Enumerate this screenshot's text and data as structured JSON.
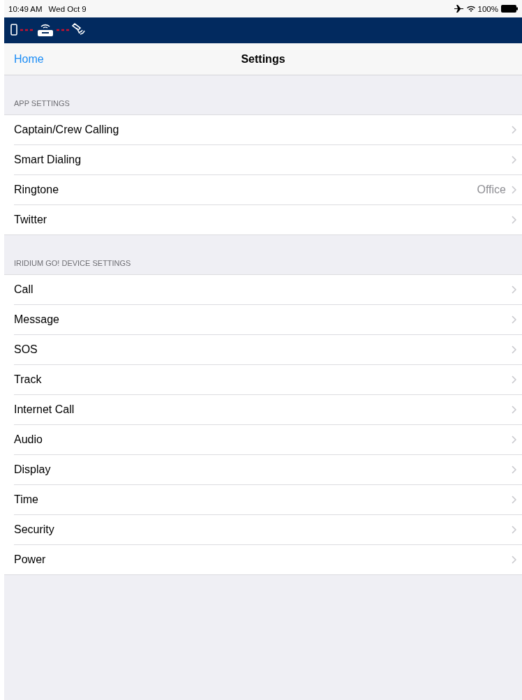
{
  "status_bar": {
    "time": "10:49 AM",
    "date": "Wed Oct 9",
    "battery": "100%"
  },
  "nav_bar": {
    "back": "Home",
    "title": "Settings"
  },
  "sections": [
    {
      "header": "APP SETTINGS",
      "rows": [
        {
          "label": "Captain/Crew Calling"
        },
        {
          "label": "Smart Dialing"
        },
        {
          "label": "Ringtone",
          "value": "Office"
        },
        {
          "label": "Twitter"
        }
      ]
    },
    {
      "header": "IRIDIUM GO! DEVICE SETTINGS",
      "rows": [
        {
          "label": "Call"
        },
        {
          "label": "Message"
        },
        {
          "label": "SOS"
        },
        {
          "label": "Track"
        },
        {
          "label": "Internet Call"
        },
        {
          "label": "Audio"
        },
        {
          "label": "Display"
        },
        {
          "label": "Time"
        },
        {
          "label": "Security"
        },
        {
          "label": "Power"
        }
      ]
    }
  ]
}
